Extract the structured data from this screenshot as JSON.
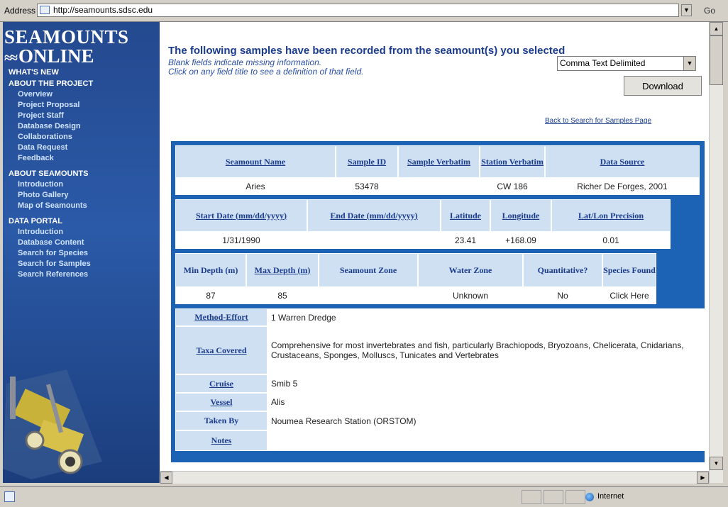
{
  "browser": {
    "address_label": "Address",
    "url": "http://seamounts.sdsc.edu",
    "go_label": "Go"
  },
  "sidebar": {
    "logo_line1": "SEAMOUNTS",
    "logo_line2": "ONLINE",
    "sections": [
      {
        "heading": "WHAT'S NEW",
        "items": []
      },
      {
        "heading": "ABOUT THE PROJECT",
        "items": [
          "Overview",
          "Project Proposal",
          "Project Staff",
          "Database Design",
          "Collaborations",
          "Data Request",
          "Feedback"
        ]
      },
      {
        "heading": "ABOUT SEAMOUNTS",
        "items": [
          "Introduction",
          "Photo Gallery",
          "Map of Seamounts"
        ]
      },
      {
        "heading": "DATA PORTAL",
        "items": [
          "Introduction",
          "Database Content",
          "Search for Species",
          "Search for Samples",
          "Search References"
        ]
      }
    ]
  },
  "main": {
    "title": "The following samples have been recorded from the seamount(s) you selected",
    "subtitle_1": "Blank fields indicate missing information.",
    "subtitle_2": "Click on any field title to see a definition of that field.",
    "format_select": "Comma Text Delimited",
    "download_label": "Download",
    "back_link": "Back to Search for Samples Page"
  },
  "table": {
    "row1_headers": [
      "Seamount Name",
      "Sample ID",
      "Sample Verbatim",
      "Station Verbatim",
      "Data Source"
    ],
    "row1_values": [
      "Aries",
      "53478",
      "",
      "CW 186",
      "Richer De Forges, 2001"
    ],
    "row2_headers": [
      "Start Date (mm/dd/yyyy)",
      "End Date (mm/dd/yyyy)",
      "Latitude",
      "Longitude",
      "Lat/Lon Precision"
    ],
    "row2_values": [
      "1/31/1990",
      "",
      "23.41",
      "+168.09",
      "0.01"
    ],
    "row3_headers": [
      "Min Depth (m)",
      "Max Depth (m)",
      "Seamount Zone",
      "Water Zone",
      "Quantitative?",
      "Species Found"
    ],
    "row3_values": [
      "87",
      "85",
      "",
      "Unknown",
      "No",
      "Click Here"
    ],
    "details": [
      {
        "label": "Method-Effort",
        "value": "1 Warren Dredge"
      },
      {
        "label": "Taxa Covered",
        "value": "Comprehensive for most invertebrates and fish, particularly Brachiopods, Bryozoans, Chelicerata, Cnidarians, Crustaceans, Sponges, Molluscs, Tunicates and Vertebrates"
      },
      {
        "label": "Cruise",
        "value": "Smib 5"
      },
      {
        "label": "Vessel",
        "value": "Alis"
      },
      {
        "label": "Taken By",
        "value": "Noumea Research Station (ORSTOM)"
      },
      {
        "label": "Notes",
        "value": ""
      }
    ]
  },
  "status": {
    "zone": "Internet"
  },
  "colors": {
    "sidebar": "#2b5aa8",
    "title": "#1a3c8c",
    "table_border": "#1d63b5",
    "header_cell": "#cfe0f3"
  }
}
